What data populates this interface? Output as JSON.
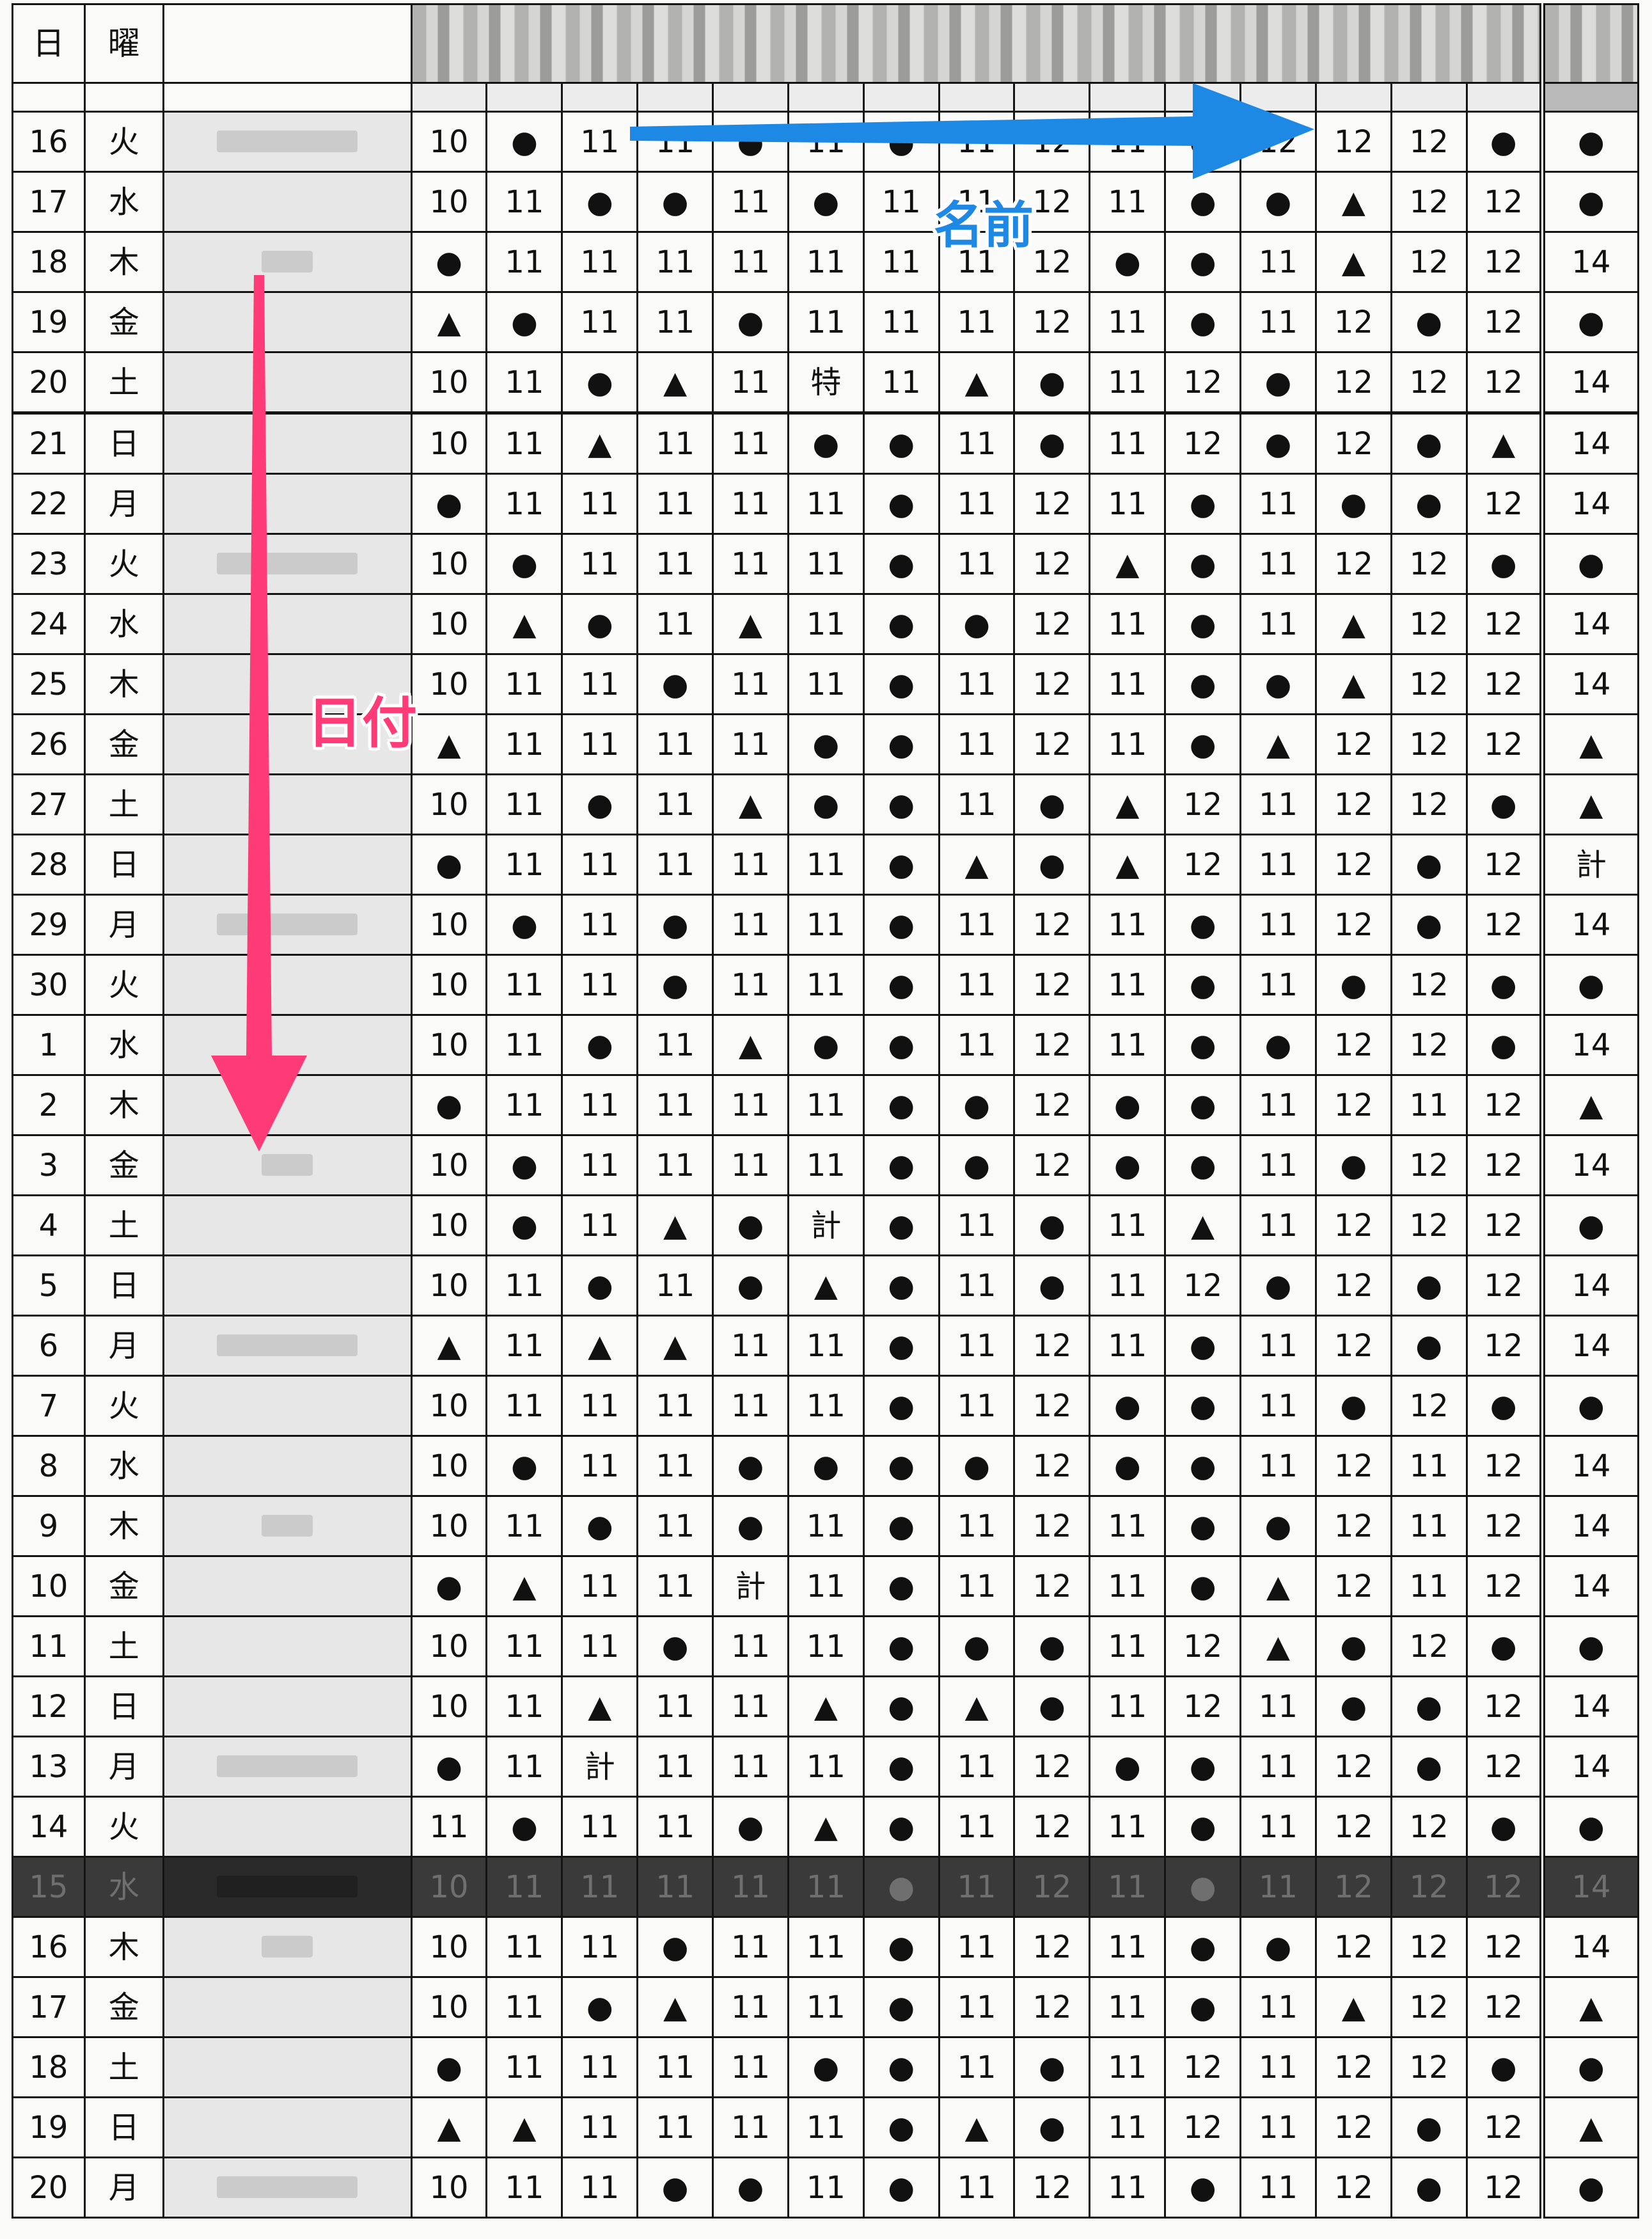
{
  "header": {
    "date_label": "日",
    "dow_label": "曜"
  },
  "annotations": {
    "date_axis_label": "日付",
    "name_axis_label": "名前",
    "date_arrow_color": "#ff3b77",
    "name_arrow_color": "#1e88e5"
  },
  "symbols": {
    "circle": "●",
    "triangle": "▲"
  },
  "highlighted_row_index": 29,
  "rows": [
    {
      "date": "16",
      "dow": "火",
      "cells": [
        "10",
        "●",
        "11",
        "11",
        "●",
        "11",
        "●",
        "11",
        "12",
        "11",
        "●",
        "12",
        "12",
        "12",
        "●"
      ],
      "last": "●"
    },
    {
      "date": "17",
      "dow": "水",
      "cells": [
        "10",
        "11",
        "●",
        "●",
        "11",
        "●",
        "11",
        "11",
        "12",
        "11",
        "●",
        "●",
        "▲",
        "12",
        "12"
      ],
      "last": "●"
    },
    {
      "date": "18",
      "dow": "木",
      "cells": [
        "●",
        "11",
        "11",
        "11",
        "11",
        "11",
        "11",
        "11",
        "12",
        "●",
        "●",
        "11",
        "▲",
        "12",
        "12"
      ],
      "last": "14"
    },
    {
      "date": "19",
      "dow": "金",
      "cells": [
        "▲",
        "●",
        "11",
        "11",
        "●",
        "11",
        "11",
        "11",
        "12",
        "11",
        "●",
        "11",
        "12",
        "●",
        "12"
      ],
      "last": "●"
    },
    {
      "date": "20",
      "dow": "土",
      "cells": [
        "10",
        "11",
        "●",
        "▲",
        "11",
        "特",
        "11",
        "▲",
        "●",
        "11",
        "12",
        "●",
        "12",
        "12",
        "12"
      ],
      "last": "14"
    },
    {
      "date": "21",
      "dow": "日",
      "cells": [
        "10",
        "11",
        "▲",
        "11",
        "11",
        "●",
        "●",
        "11",
        "●",
        "11",
        "12",
        "●",
        "12",
        "●",
        "▲"
      ],
      "last": "14"
    },
    {
      "date": "22",
      "dow": "月",
      "cells": [
        "●",
        "11",
        "11",
        "11",
        "11",
        "11",
        "●",
        "11",
        "12",
        "11",
        "●",
        "11",
        "●",
        "●",
        "12"
      ],
      "last": "14"
    },
    {
      "date": "23",
      "dow": "火",
      "cells": [
        "10",
        "●",
        "11",
        "11",
        "11",
        "11",
        "●",
        "11",
        "12",
        "▲",
        "●",
        "11",
        "12",
        "12",
        "●"
      ],
      "last": "●"
    },
    {
      "date": "24",
      "dow": "水",
      "cells": [
        "10",
        "▲",
        "●",
        "11",
        "▲",
        "11",
        "●",
        "●",
        "12",
        "11",
        "●",
        "11",
        "▲",
        "12",
        "12"
      ],
      "last": "14"
    },
    {
      "date": "25",
      "dow": "木",
      "cells": [
        "10",
        "11",
        "11",
        "●",
        "11",
        "11",
        "●",
        "11",
        "12",
        "11",
        "●",
        "●",
        "▲",
        "12",
        "12"
      ],
      "last": "14"
    },
    {
      "date": "26",
      "dow": "金",
      "cells": [
        "▲",
        "11",
        "11",
        "11",
        "11",
        "●",
        "●",
        "11",
        "12",
        "11",
        "●",
        "▲",
        "12",
        "12",
        "12"
      ],
      "last": "▲"
    },
    {
      "date": "27",
      "dow": "土",
      "cells": [
        "10",
        "11",
        "●",
        "11",
        "▲",
        "●",
        "●",
        "11",
        "●",
        "▲",
        "12",
        "11",
        "12",
        "12",
        "●"
      ],
      "last": "▲"
    },
    {
      "date": "28",
      "dow": "日",
      "cells": [
        "●",
        "11",
        "11",
        "11",
        "11",
        "11",
        "●",
        "▲",
        "●",
        "▲",
        "12",
        "11",
        "12",
        "●",
        "12"
      ],
      "last": "計"
    },
    {
      "date": "29",
      "dow": "月",
      "cells": [
        "10",
        "●",
        "11",
        "●",
        "11",
        "11",
        "●",
        "11",
        "12",
        "11",
        "●",
        "11",
        "12",
        "●",
        "12"
      ],
      "last": "14"
    },
    {
      "date": "30",
      "dow": "火",
      "cells": [
        "10",
        "11",
        "11",
        "●",
        "11",
        "11",
        "●",
        "11",
        "12",
        "11",
        "●",
        "11",
        "●",
        "12",
        "●"
      ],
      "last": "●"
    },
    {
      "date": "1",
      "dow": "水",
      "cells": [
        "10",
        "11",
        "●",
        "11",
        "▲",
        "●",
        "●",
        "11",
        "12",
        "11",
        "●",
        "●",
        "12",
        "12",
        "●"
      ],
      "last": "14"
    },
    {
      "date": "2",
      "dow": "木",
      "cells": [
        "●",
        "11",
        "11",
        "11",
        "11",
        "11",
        "●",
        "●",
        "12",
        "●",
        "●",
        "11",
        "12",
        "11",
        "12"
      ],
      "last": "▲"
    },
    {
      "date": "3",
      "dow": "金",
      "cells": [
        "10",
        "●",
        "11",
        "11",
        "11",
        "11",
        "●",
        "●",
        "12",
        "●",
        "●",
        "11",
        "●",
        "12",
        "12"
      ],
      "last": "14"
    },
    {
      "date": "4",
      "dow": "土",
      "cells": [
        "10",
        "●",
        "11",
        "▲",
        "●",
        "計",
        "●",
        "11",
        "●",
        "11",
        "▲",
        "11",
        "12",
        "12",
        "12"
      ],
      "last": "●"
    },
    {
      "date": "5",
      "dow": "日",
      "cells": [
        "10",
        "11",
        "●",
        "11",
        "●",
        "▲",
        "●",
        "11",
        "●",
        "11",
        "12",
        "●",
        "12",
        "●",
        "12"
      ],
      "last": "14"
    },
    {
      "date": "6",
      "dow": "月",
      "cells": [
        "▲",
        "11",
        "▲",
        "▲",
        "11",
        "11",
        "●",
        "11",
        "12",
        "11",
        "●",
        "11",
        "12",
        "●",
        "12"
      ],
      "last": "14"
    },
    {
      "date": "7",
      "dow": "火",
      "cells": [
        "10",
        "11",
        "11",
        "11",
        "11",
        "11",
        "●",
        "11",
        "12",
        "●",
        "●",
        "11",
        "●",
        "12",
        "●"
      ],
      "last": "●"
    },
    {
      "date": "8",
      "dow": "水",
      "cells": [
        "10",
        "●",
        "11",
        "11",
        "●",
        "●",
        "●",
        "●",
        "12",
        "●",
        "●",
        "11",
        "12",
        "11",
        "12"
      ],
      "last": "14"
    },
    {
      "date": "9",
      "dow": "木",
      "cells": [
        "10",
        "11",
        "●",
        "11",
        "●",
        "11",
        "●",
        "11",
        "12",
        "11",
        "●",
        "●",
        "12",
        "11",
        "12"
      ],
      "last": "14"
    },
    {
      "date": "10",
      "dow": "金",
      "cells": [
        "●",
        "▲",
        "11",
        "11",
        "計",
        "11",
        "●",
        "11",
        "12",
        "11",
        "●",
        "▲",
        "12",
        "11",
        "12"
      ],
      "last": "14"
    },
    {
      "date": "11",
      "dow": "土",
      "cells": [
        "10",
        "11",
        "11",
        "●",
        "11",
        "11",
        "●",
        "●",
        "●",
        "11",
        "12",
        "▲",
        "●",
        "12",
        "●"
      ],
      "last": "●"
    },
    {
      "date": "12",
      "dow": "日",
      "cells": [
        "10",
        "11",
        "▲",
        "11",
        "11",
        "▲",
        "●",
        "▲",
        "●",
        "11",
        "12",
        "11",
        "●",
        "●",
        "12"
      ],
      "last": "14"
    },
    {
      "date": "13",
      "dow": "月",
      "cells": [
        "●",
        "11",
        "計",
        "11",
        "11",
        "11",
        "●",
        "11",
        "12",
        "●",
        "●",
        "11",
        "12",
        "●",
        "12"
      ],
      "last": "14"
    },
    {
      "date": "14",
      "dow": "火",
      "cells": [
        "11",
        "●",
        "11",
        "11",
        "●",
        "▲",
        "●",
        "11",
        "12",
        "11",
        "●",
        "11",
        "12",
        "12",
        "●"
      ],
      "last": "●"
    },
    {
      "date": "15",
      "dow": "水",
      "cells": [
        "10",
        "11",
        "11",
        "11",
        "11",
        "11",
        "●",
        "11",
        "12",
        "11",
        "●",
        "11",
        "12",
        "12",
        "12"
      ],
      "last": "14"
    },
    {
      "date": "16",
      "dow": "木",
      "cells": [
        "10",
        "11",
        "11",
        "●",
        "11",
        "11",
        "●",
        "11",
        "12",
        "11",
        "●",
        "●",
        "12",
        "12",
        "12"
      ],
      "last": "14"
    },
    {
      "date": "17",
      "dow": "金",
      "cells": [
        "10",
        "11",
        "●",
        "▲",
        "11",
        "11",
        "●",
        "11",
        "12",
        "11",
        "●",
        "11",
        "▲",
        "12",
        "12"
      ],
      "last": "▲"
    },
    {
      "date": "18",
      "dow": "土",
      "cells": [
        "●",
        "11",
        "11",
        "11",
        "11",
        "●",
        "●",
        "11",
        "●",
        "11",
        "12",
        "11",
        "12",
        "12",
        "●"
      ],
      "last": "●"
    },
    {
      "date": "19",
      "dow": "日",
      "cells": [
        "▲",
        "▲",
        "11",
        "11",
        "11",
        "11",
        "●",
        "▲",
        "●",
        "11",
        "12",
        "11",
        "12",
        "●",
        "12"
      ],
      "last": "▲"
    },
    {
      "date": "20",
      "dow": "月",
      "cells": [
        "10",
        "11",
        "11",
        "●",
        "●",
        "11",
        "●",
        "11",
        "12",
        "11",
        "●",
        "11",
        "12",
        "●",
        "12"
      ],
      "last": "●"
    }
  ]
}
